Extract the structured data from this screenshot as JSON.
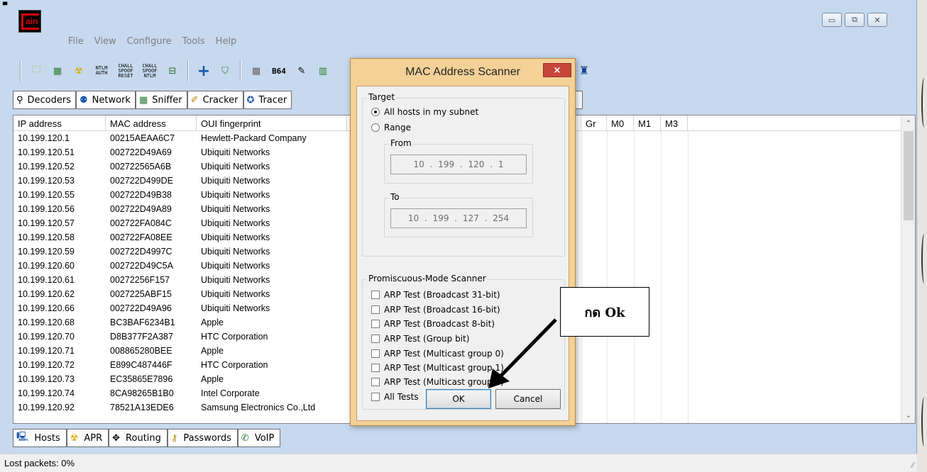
{
  "menu": [
    "File",
    "View",
    "Configure",
    "Tools",
    "Help"
  ],
  "toolbar": {
    "icons": [
      "folder-icon",
      "network-card-icon",
      "hazard-icon",
      "ntlm-auth-icon",
      "chall-spoof-reset-icon",
      "chall-spoof-ntlm-icon",
      "certificate-icon",
      "add-icon",
      "shield-icon",
      "scan-icon",
      "base64-icon",
      "hash-icon",
      "chart-icon",
      "person-icon"
    ],
    "text_icons": {
      "ntlm": [
        "NTLM",
        "AUTH"
      ],
      "chall1": [
        "CHALL",
        "SPOOF",
        "RESET"
      ],
      "chall2": [
        "CHALL",
        "SPOOF",
        "NTLM"
      ],
      "b64": "B64"
    }
  },
  "top_tabs": [
    "Decoders",
    "Network",
    "Sniffer",
    "Cracker",
    "Tracer"
  ],
  "columns": {
    "ip": "IP address",
    "mac": "MAC address",
    "oui": "OUI fingerprint",
    "gr": "Gr",
    "m0": "M0",
    "m1": "M1",
    "m3": "M3"
  },
  "hosts": [
    {
      "ip": "10.199.120.1",
      "mac": "00215AEAA6C7",
      "oui": "Hewlett-Packard Company"
    },
    {
      "ip": "10.199.120.51",
      "mac": "002722D49A69",
      "oui": "Ubiquiti Networks"
    },
    {
      "ip": "10.199.120.52",
      "mac": "002722565A6B",
      "oui": "Ubiquiti Networks"
    },
    {
      "ip": "10.199.120.53",
      "mac": "002722D499DE",
      "oui": "Ubiquiti Networks"
    },
    {
      "ip": "10.199.120.55",
      "mac": "002722D49B38",
      "oui": "Ubiquiti Networks"
    },
    {
      "ip": "10.199.120.56",
      "mac": "002722D49A89",
      "oui": "Ubiquiti Networks"
    },
    {
      "ip": "10.199.120.57",
      "mac": "002722FA084C",
      "oui": "Ubiquiti Networks"
    },
    {
      "ip": "10.199.120.58",
      "mac": "002722FA08EE",
      "oui": "Ubiquiti Networks"
    },
    {
      "ip": "10.199.120.59",
      "mac": "002722D4997C",
      "oui": "Ubiquiti Networks"
    },
    {
      "ip": "10.199.120.60",
      "mac": "002722D49C5A",
      "oui": "Ubiquiti Networks"
    },
    {
      "ip": "10.199.120.61",
      "mac": "00272256F157",
      "oui": "Ubiquiti Networks"
    },
    {
      "ip": "10.199.120.62",
      "mac": "0027225ABF15",
      "oui": "Ubiquiti Networks"
    },
    {
      "ip": "10.199.120.66",
      "mac": "002722D49A96",
      "oui": "Ubiquiti Networks"
    },
    {
      "ip": "10.199.120.68",
      "mac": "BC3BAF6234B1",
      "oui": "Apple"
    },
    {
      "ip": "10.199.120.70",
      "mac": "D8B377F2A387",
      "oui": "HTC Corporation"
    },
    {
      "ip": "10.199.120.71",
      "mac": "008865280BEE",
      "oui": "Apple"
    },
    {
      "ip": "10.199.120.72",
      "mac": "E899C487446F",
      "oui": "HTC Corporation"
    },
    {
      "ip": "10.199.120.73",
      "mac": "EC35865E7896",
      "oui": "Apple"
    },
    {
      "ip": "10.199.120.74",
      "mac": "8CA98265B1B0",
      "oui": "Intel Corporate"
    },
    {
      "ip": "10.199.120.92",
      "mac": "78521A13EDE6",
      "oui": "Samsung Electronics Co.,Ltd"
    }
  ],
  "bottom_tabs": [
    "Hosts",
    "APR",
    "Routing",
    "Passwords",
    "VoIP"
  ],
  "status": "Lost packets:  0%",
  "dialog": {
    "title": "MAC Address Scanner",
    "close": "×",
    "target_group": "Target",
    "all_hosts": "All hosts in my subnet",
    "range": "Range",
    "from_label": "From",
    "from_ip": "10 . 199 . 120 . 1",
    "to_label": "To",
    "to_ip": "10 . 199 . 127 . 254",
    "promisc_group": "Promiscuous-Mode Scanner",
    "tests": [
      "ARP Test (Broadcast 31-bit)",
      "ARP Test (Broadcast 16-bit)",
      "ARP Test (Broadcast 8-bit)",
      "ARP Test (Group bit)",
      "ARP Test (Multicast group 0)",
      "ARP Test (Multicast group 1)",
      "ARP Test (Multicast group 3)",
      "All Tests"
    ],
    "ok": "OK",
    "cancel": "Cancel"
  },
  "annotation": "กด Ok"
}
